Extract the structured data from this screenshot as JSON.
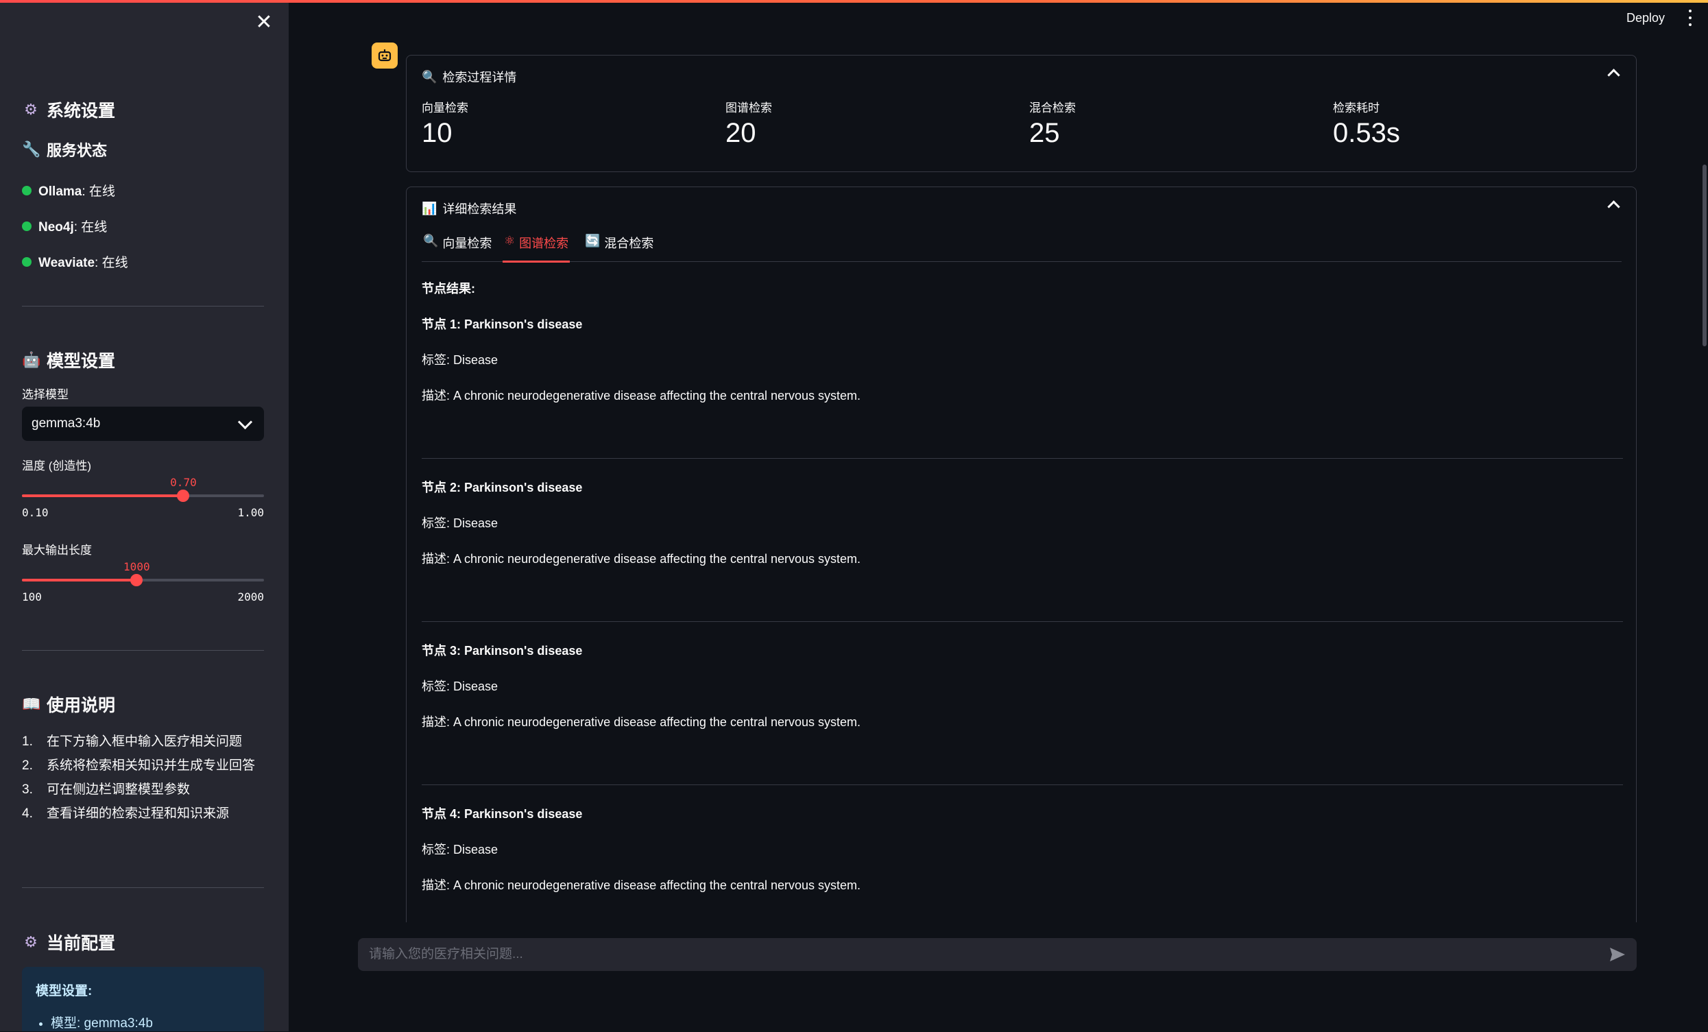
{
  "sidebar": {
    "system_settings": "系统设置",
    "service_status": "服务状态",
    "services": [
      {
        "name": "Ollama",
        "status": ": 在线"
      },
      {
        "name": "Neo4j",
        "status": ": 在线"
      },
      {
        "name": "Weaviate",
        "status": ": 在线"
      }
    ],
    "model_settings": "模型设置",
    "select_model_label": "选择模型",
    "selected_model": "gemma3:4b",
    "temperature": {
      "label": "温度 (创造性)",
      "value": "0.70",
      "min": "0.10",
      "max": "1.00",
      "fraction": 0.667
    },
    "max_tokens": {
      "label": "最大输出长度",
      "value": "1000",
      "min": "100",
      "max": "2000",
      "fraction": 0.474
    },
    "usage_title": "使用说明",
    "usage_steps": [
      {
        "n": "1.",
        "text": "在下方输入框中输入医疗相关问题"
      },
      {
        "n": "2.",
        "text": "系统将检索相关知识并生成专业回答"
      },
      {
        "n": "3.",
        "text": "可在侧边栏调整模型参数"
      },
      {
        "n": "4.",
        "text": "查看详细的检索过程和知识来源"
      }
    ],
    "current_config": "当前配置",
    "config_box": {
      "title": "模型设置:",
      "model_line": "模型: gemma3:4b"
    }
  },
  "header": {
    "deploy": "Deploy"
  },
  "retrieval_process": {
    "title": "检索过程详情",
    "metrics": [
      {
        "label": "向量检索",
        "value": "10"
      },
      {
        "label": "图谱检索",
        "value": "20"
      },
      {
        "label": "混合检索",
        "value": "25"
      },
      {
        "label": "检索耗时",
        "value": "0.53s"
      }
    ]
  },
  "detailed_results": {
    "title": "详细检索结果",
    "tabs": [
      {
        "label": "向量检索",
        "icon": "magnifier-icon"
      },
      {
        "label": "图谱检索",
        "icon": "atom-icon"
      },
      {
        "label": "混合检索",
        "icon": "refresh-icon"
      }
    ],
    "active_tab": 1,
    "section_title": "节点结果:",
    "nodes": [
      {
        "title": "节点 1: Parkinson's disease",
        "tag": "标签: Disease",
        "desc": "描述: A chronic neurodegenerative disease affecting the central nervous system."
      },
      {
        "title": "节点 2: Parkinson's disease",
        "tag": "标签: Disease",
        "desc": "描述: A chronic neurodegenerative disease affecting the central nervous system."
      },
      {
        "title": "节点 3: Parkinson's disease",
        "tag": "标签: Disease",
        "desc": "描述: A chronic neurodegenerative disease affecting the central nervous system."
      },
      {
        "title": "节点 4: Parkinson's disease",
        "tag": "标签: Disease",
        "desc": "描述: A chronic neurodegenerative disease affecting the central nervous system."
      }
    ]
  },
  "chat": {
    "placeholder": "请输入您的医疗相关问题..."
  },
  "colors": {
    "accent": "#ff4b4b",
    "online": "#21c354",
    "avatar": "#ffbd45",
    "info_bg": "#172d43"
  }
}
